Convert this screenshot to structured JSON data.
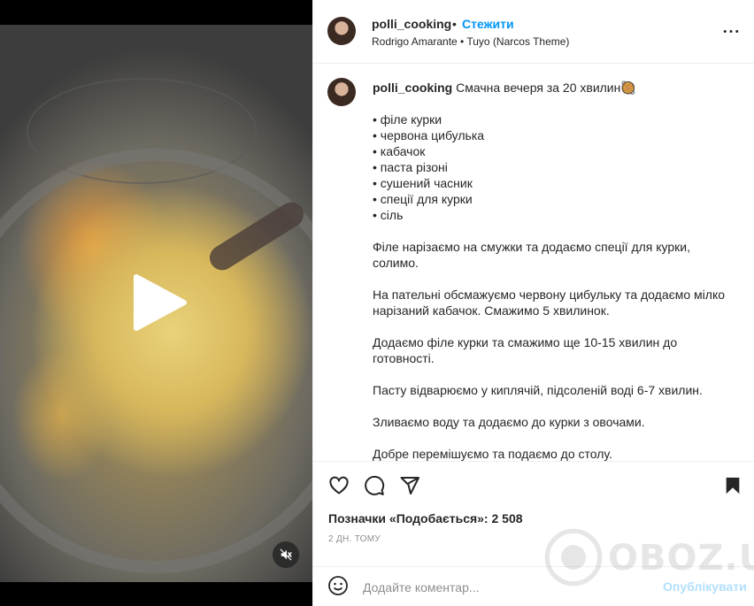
{
  "header": {
    "username": "polli_cooking",
    "dot": "•",
    "follow_label": "Стежити",
    "audio": "Rodrigo Amarante • Tuyo (Narcos Theme)"
  },
  "caption": {
    "username": "polli_cooking",
    "intro": "Смачна вечеря за 20 хвилин🥘",
    "ingredients": [
      "• філе курки",
      "• червона цибулька",
      "• кабачок",
      "• паста різоні",
      "• сушений часник",
      "• спеції для курки",
      "• сіль"
    ],
    "steps": [
      "Філе нарізаємо на смужки та додаємо спеції для курки, солимо.",
      "На пательні обсмажуємо червону цибульку та додаємо мілко нарізаний кабачок. Смажимо 5 хвилинок.",
      "Додаємо філе курки та смажимо ще 10-15 хвилин до готовності.",
      "Пасту відварюємо у киплячій, підсоленій воді 6-7 хвилин.",
      "Зливаємо воду та додаємо до курки з овочами.",
      "Добре перемішуємо та подаємо до столу."
    ]
  },
  "likes_text": "Позначки «Подобається»: 2 508",
  "timestamp": "2 ДН. ТОМУ",
  "comment": {
    "placeholder": "Додайте коментар...",
    "post_label": "Опублікувати"
  },
  "watermark": {
    "text": "OBOZ.UA"
  },
  "colors": {
    "accent": "#0095f6",
    "post_disabled": "#b2dffc",
    "text": "#262626",
    "muted": "#8e8e8e"
  },
  "icons": {
    "more": "more-horizontal-icon",
    "like": "heart-icon",
    "comment": "comment-icon",
    "share": "paper-plane-icon",
    "save": "bookmark-icon",
    "emoji": "smiley-icon",
    "play": "play-icon",
    "mute": "speaker-muted-icon"
  }
}
